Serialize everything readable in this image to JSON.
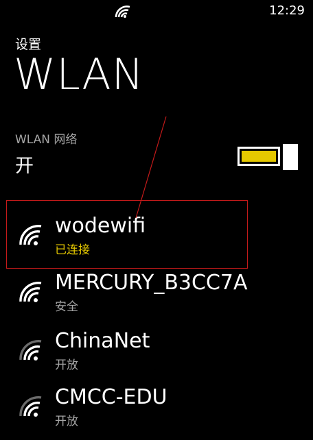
{
  "status_bar": {
    "time": "12:29",
    "signal_icon": "wifi-signal-icon"
  },
  "header": {
    "breadcrumb": "设置",
    "title": "WLAN"
  },
  "wlan_toggle": {
    "label": "WLAN 网络",
    "state_text": "开",
    "on": true,
    "accent": "#e5c800"
  },
  "networks": [
    {
      "name": "wodewifi",
      "status": "已连接",
      "connected": true,
      "icon": "wifi-full-icon"
    },
    {
      "name": "MERCURY_B3CC7A",
      "status": "安全",
      "connected": false,
      "icon": "wifi-full-icon"
    },
    {
      "name": "ChinaNet",
      "status": "开放",
      "connected": false,
      "icon": "wifi-medium-icon"
    },
    {
      "name": "CMCC-EDU",
      "status": "开放",
      "connected": false,
      "icon": "wifi-medium-icon"
    }
  ],
  "colors": {
    "background": "#000000",
    "text": "#ffffff",
    "secondary": "#a6a6a6",
    "accent": "#e5c800",
    "annotation": "#c41a1a"
  }
}
